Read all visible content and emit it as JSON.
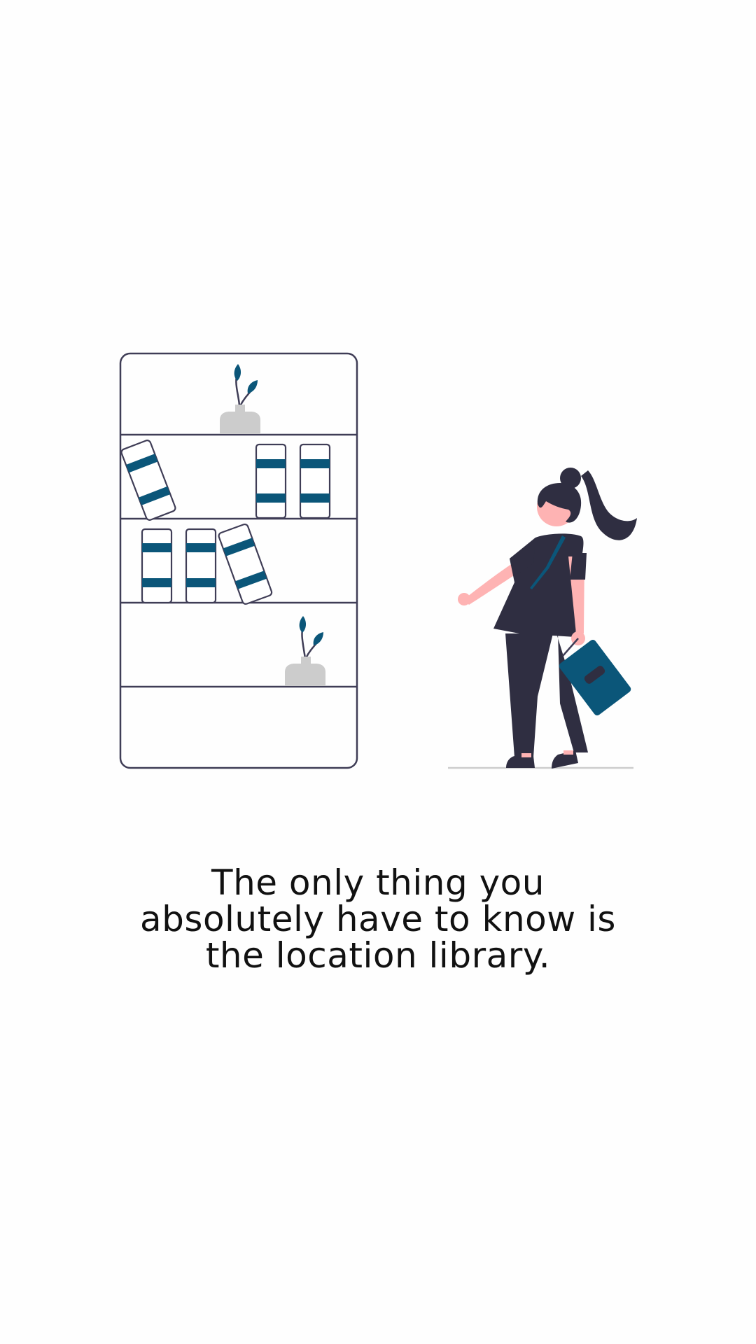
{
  "onboarding": {
    "caption_lines": [
      "The only thing you",
      "absolutely have to know is",
      "the location library."
    ]
  },
  "colors": {
    "background": "#fefefe",
    "accent": "#0b5679",
    "outline": "#3f3d56",
    "skin": "#feb3b3",
    "figure_dark": "#2f2e41",
    "pot": "#cccccc",
    "caption_text": "#111111"
  },
  "icons": {
    "bookshelf": "bookshelf-illustration",
    "person": "person-holding-book-illustration"
  }
}
